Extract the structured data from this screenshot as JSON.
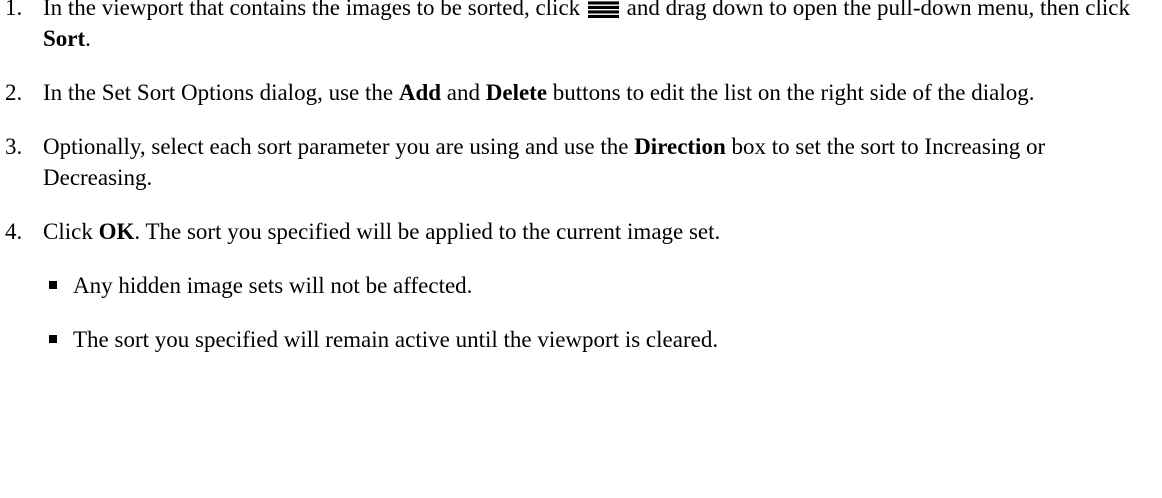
{
  "steps": [
    {
      "number": "1.",
      "pre": "In the viewport that contains the images to be sorted, click ",
      "icon": "menu-bars-icon",
      "mid": " and drag down to open the pull-down menu, then click ",
      "bold": "Sort",
      "post": "."
    },
    {
      "number": "2.",
      "pre": "In the Set Sort Options dialog, use the ",
      "bold1": "Add",
      "mid": " and ",
      "bold2": "Delete",
      "post": " buttons to edit the list on the right side of the dialog."
    },
    {
      "number": "3.",
      "pre": "Optionally, select each sort parameter you are using and use the ",
      "bold": "Direction",
      "post": " box to set the sort to Increasing or Decreasing."
    },
    {
      "number": "4.",
      "pre": "Click ",
      "bold": "OK",
      "post": ". The sort you specified will be applied to the current image set."
    }
  ],
  "bullets": [
    "Any hidden image sets will not be affected.",
    "The sort you specified will remain active until the viewport is cleared."
  ]
}
